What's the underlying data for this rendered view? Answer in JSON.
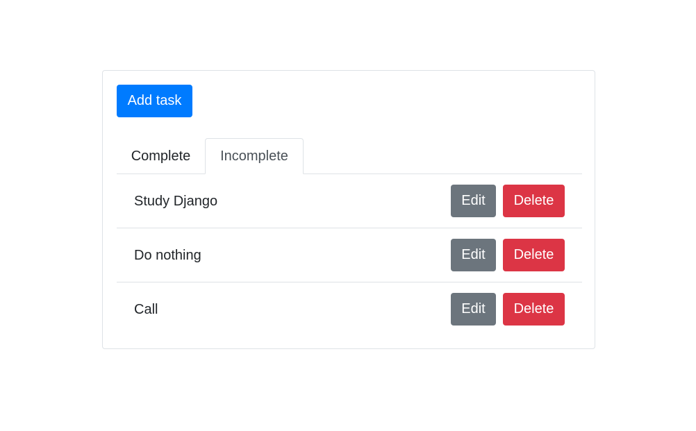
{
  "toolbar": {
    "add_label": "Add task"
  },
  "tabs": [
    {
      "label": "Complete",
      "active": false
    },
    {
      "label": "Incomplete",
      "active": true
    }
  ],
  "tasks": [
    {
      "label": "Study Django",
      "edit_label": "Edit",
      "delete_label": "Delete"
    },
    {
      "label": "Do nothing",
      "edit_label": "Edit",
      "delete_label": "Delete"
    },
    {
      "label": "Call",
      "edit_label": "Edit",
      "delete_label": "Delete"
    }
  ],
  "colors": {
    "primary": "#007bff",
    "secondary": "#6c757d",
    "danger": "#dc3545",
    "border": "#dee2e6"
  }
}
